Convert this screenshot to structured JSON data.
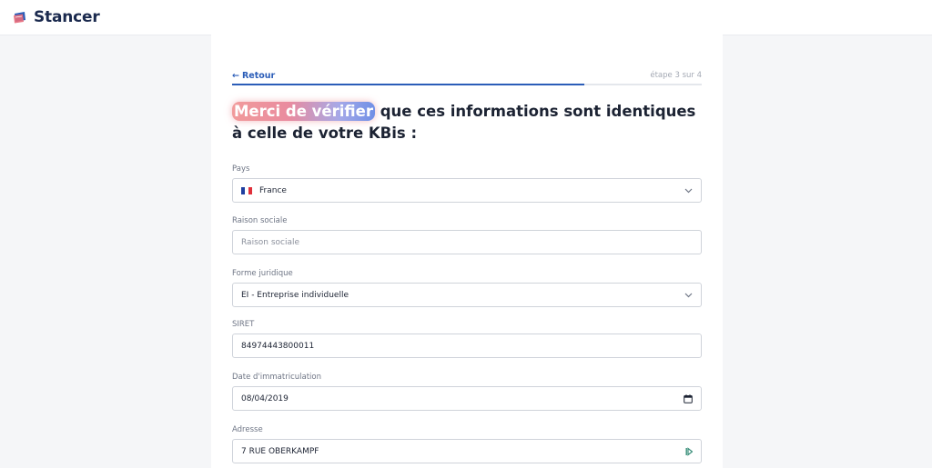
{
  "brand": {
    "name": "Stancer"
  },
  "nav": {
    "back_label": "Retour",
    "step_label": "étape 3 sur 4",
    "progress": 0.75
  },
  "title": {
    "highlight": "Merci de vérifier",
    "rest": " que ces informations sont identiques à celle de votre KBis :"
  },
  "form": {
    "country": {
      "label": "Pays",
      "value": "France"
    },
    "company_name": {
      "label": "Raison sociale",
      "placeholder": "Raison sociale"
    },
    "legal_form": {
      "label": "Forme juridique",
      "value": "EI - Entreprise individuelle"
    },
    "siret": {
      "label": "SIRET",
      "value": "84974443800011"
    },
    "registration_date": {
      "label": "Date d'immatriculation",
      "value": "08/04/2019"
    },
    "address": {
      "label": "Adresse",
      "value": "7 RUE OBERKAMPF"
    }
  },
  "colors": {
    "accent": "#2b5db8",
    "brand_navy": "#1b2a4e"
  },
  "icons": {
    "back": "arrow-left-icon",
    "select": "chevron-down-icon",
    "date": "calendar-icon",
    "autofill": "autofill-icon"
  }
}
